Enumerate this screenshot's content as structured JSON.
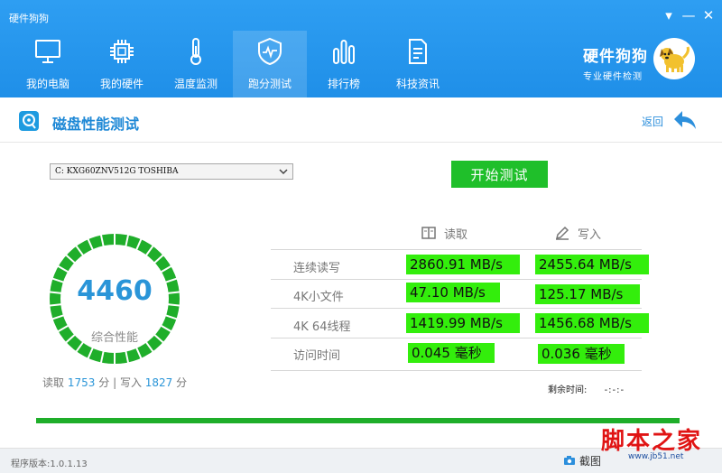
{
  "window": {
    "title": "硬件狗狗",
    "menu_glyph": "▾",
    "min_glyph": "—",
    "close_glyph": "✕"
  },
  "nav": {
    "items": [
      {
        "label": "我的电脑",
        "icon": "monitor-icon"
      },
      {
        "label": "我的硬件",
        "icon": "chip-icon"
      },
      {
        "label": "温度监测",
        "icon": "thermometer-icon"
      },
      {
        "label": "跑分测试",
        "icon": "benchmark-shield-icon",
        "active": true
      },
      {
        "label": "排行榜",
        "icon": "ranking-bars-icon"
      },
      {
        "label": "科技资讯",
        "icon": "news-document-icon"
      }
    ]
  },
  "brand": {
    "name": "硬件狗狗",
    "slogan": "专业硬件检测",
    "logo_icon": "dog-logo-icon"
  },
  "section": {
    "title": "磁盘性能测试",
    "icon": "disk-test-icon",
    "back_label": "返回",
    "back_icon": "back-arrow-icon"
  },
  "drive_select": {
    "value": "C: KXG60ZNV512G TOSHIBA"
  },
  "start_button": {
    "label": "开始测试"
  },
  "gauge": {
    "score": "4460",
    "label": "综合性能",
    "fill_fraction": 1.0
  },
  "scores": {
    "read_label": "读取",
    "read_value": "1753",
    "unit": "分",
    "separator": "|",
    "write_label": "写入",
    "write_value": "1827"
  },
  "table": {
    "read_header": "读取",
    "write_header": "写入",
    "rows": [
      {
        "label": "连续读写",
        "read": "2860.91 MB/s",
        "write": "2455.64 MB/s"
      },
      {
        "label": "4K小文件",
        "read": "47.10 MB/s",
        "write": "125.17 MB/s"
      },
      {
        "label": "4K 64线程",
        "read": "1419.99 MB/s",
        "write": "1456.68 MB/s"
      },
      {
        "label": "访问时间",
        "read": "0.045 毫秒",
        "write": "0.036 毫秒"
      }
    ]
  },
  "remaining": {
    "label": "剩余时间:",
    "value": "-:-:-"
  },
  "progress": {
    "fraction": 1.0
  },
  "footer": {
    "version": "程序版本:1.0.1.13",
    "screenshot_label": "截图"
  },
  "watermark": {
    "main": "脚本之家",
    "url": "www.jb51.net"
  },
  "colors": {
    "accent_blue": "#1f8fe8",
    "score_blue": "#2a95d8",
    "highlight_green": "#33ee0c",
    "start_green": "#1fbf2a",
    "gauge_green": "#1fae2a",
    "watermark_red": "#e01414"
  }
}
